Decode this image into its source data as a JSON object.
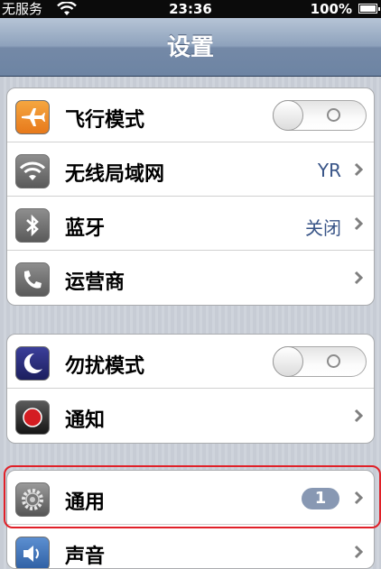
{
  "status_bar": {
    "carrier": "无服务",
    "time": "23:36",
    "battery": "100%",
    "wifi_icon": "wifi-icon",
    "battery_icon": "battery-icon"
  },
  "nav": {
    "title": "设置"
  },
  "group1": [
    {
      "label": "飞行模式",
      "icon": "airplane-icon",
      "control": "toggle",
      "toggle_on": false
    },
    {
      "label": "无线局域网",
      "icon": "wifi-icon",
      "value": "YR"
    },
    {
      "label": "蓝牙",
      "icon": "bluetooth-icon",
      "value": "关闭"
    },
    {
      "label": "运营商",
      "icon": "phone-icon"
    }
  ],
  "group2": [
    {
      "label": "勿扰模式",
      "icon": "moon-icon",
      "control": "toggle",
      "toggle_on": false
    },
    {
      "label": "通知",
      "icon": "notification-icon"
    }
  ],
  "group3": [
    {
      "label": "通用",
      "icon": "gear-icon",
      "badge": "1"
    },
    {
      "label": "声音",
      "icon": "speaker-icon"
    }
  ],
  "colors": {
    "accent_value": "#385487",
    "highlight": "#e02028",
    "badge": "#8898b3"
  }
}
